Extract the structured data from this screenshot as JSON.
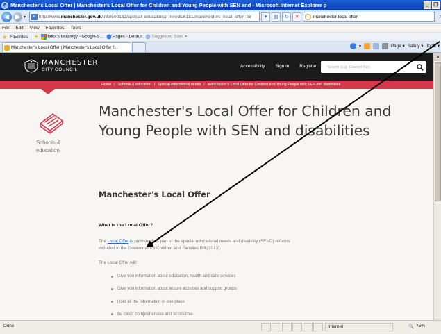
{
  "window": {
    "title": "Manchester's Local Offer | Manchester's Local Offer for Children and Young People with SEN and  - Microsoft Internet Explorer p"
  },
  "address_bar": {
    "url_prefix": "http://www.",
    "url_domain": "manchester.gov.uk",
    "url_path": "/info/500132/special_educational_needs/6181/manchesters_local_offer_for",
    "search_value": "manchester local offer"
  },
  "menu": {
    "items": [
      "File",
      "Edit",
      "View",
      "Favorites",
      "Tools"
    ]
  },
  "favorites_bar": {
    "favorites_label": "Favorites",
    "items": [
      "fallot's tetralogy - Google S...",
      "Pages - Default",
      "Suggested Sites ▾"
    ]
  },
  "tabs": {
    "active_label": "Manchester's Local Offer | Manchester's Local Offer f..."
  },
  "command_bar": {
    "page_label": "Page ▾",
    "safety_label": "Safety ▾",
    "tools_label": "Tools ▾"
  },
  "site": {
    "logo_line1": "MANCHESTER",
    "logo_line2": "CITY COUNCIL",
    "header_links": [
      "Accessibility",
      "Sign in",
      "Register"
    ],
    "search_placeholder": "Search (e.g. Council Tax)",
    "breadcrumbs": [
      "Home",
      "/",
      "Schools & education",
      "/",
      "Special educational needs",
      "/",
      "Manchester's Local Offer for Children and Young People with SEN and disabilities"
    ],
    "section_label": "Schools & education"
  },
  "content": {
    "page_title": "Manchester's Local Offer for Children and Young People with SEN and disabilities",
    "sub_title": "Manchester's Local Offer",
    "question_heading": "What is the Local Offer?",
    "intro_link": "Local Offer",
    "intro_before": "The ",
    "intro_after": " is published as part of the special educational needs and disability (SEND) reforms included in the Government's Children and Families Bill (2013).",
    "will_heading": "The Local Offer will:",
    "bullets": [
      "Give you information about education, health and care services",
      "Give you information about leisure activities and support groups",
      "Hold all the information in one place",
      "Be clear, comprehensive and accessible"
    ]
  },
  "status_bar": {
    "status_text": "Done",
    "zone_text": "Internet",
    "zoom_text": "75%"
  },
  "colors": {
    "header_bg": "#1b1b1b",
    "accent_red": "#d4384a",
    "link_blue": "#2a66c8",
    "page_bg": "#f7f6f4"
  }
}
